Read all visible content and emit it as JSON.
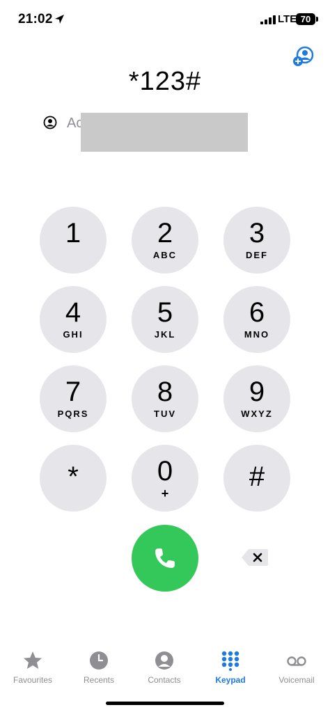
{
  "status_bar": {
    "time": "21:02",
    "network": "LTE",
    "battery": "70"
  },
  "dialer": {
    "entered_number": "*123#",
    "add_number_label": "Ac"
  },
  "keypad": {
    "keys": [
      {
        "digit": "1",
        "letters": ""
      },
      {
        "digit": "2",
        "letters": "ABC"
      },
      {
        "digit": "3",
        "letters": "DEF"
      },
      {
        "digit": "4",
        "letters": "GHI"
      },
      {
        "digit": "5",
        "letters": "JKL"
      },
      {
        "digit": "6",
        "letters": "MNO"
      },
      {
        "digit": "7",
        "letters": "PQRS"
      },
      {
        "digit": "8",
        "letters": "TUV"
      },
      {
        "digit": "9",
        "letters": "WXYZ"
      },
      {
        "digit": "*",
        "letters": ""
      },
      {
        "digit": "0",
        "letters": "+"
      },
      {
        "digit": "#",
        "letters": ""
      }
    ]
  },
  "tabs": [
    {
      "label": "Favourites",
      "icon": "star-icon"
    },
    {
      "label": "Recents",
      "icon": "clock-icon"
    },
    {
      "label": "Contacts",
      "icon": "person-circle-icon"
    },
    {
      "label": "Keypad",
      "icon": "keypad-grid-icon",
      "active": true
    },
    {
      "label": "Voicemail",
      "icon": "voicemail-icon"
    }
  ],
  "colors": {
    "accent": "#1f7ae0",
    "call_green": "#34c759",
    "key_bg": "#e5e5ea",
    "inactive_tab": "#8e8e93"
  }
}
